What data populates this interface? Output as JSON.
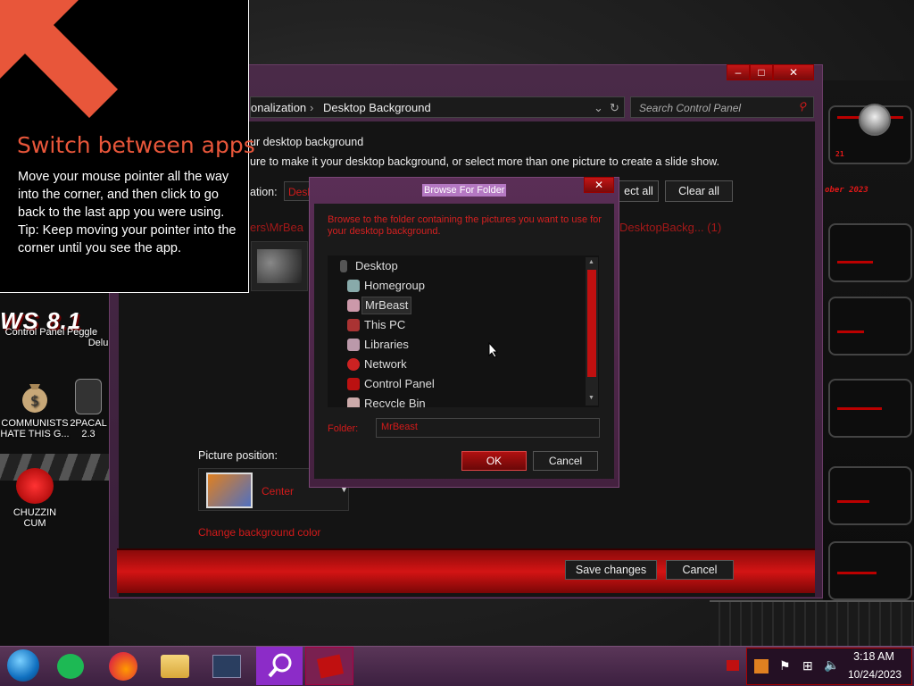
{
  "tip": {
    "title": "Switch between apps",
    "body": "Move your mouse pointer all the way into the corner, and then click to go back to the last app you were using.",
    "tip_line": "Tip: Keep moving your pointer into the corner until you see the app."
  },
  "desktop": {
    "logo_text": "WS 8.1",
    "icons": [
      {
        "label": "Control Panel"
      },
      {
        "label": "Peggle",
        "label2": "Delu"
      },
      {
        "label": "COMMUNISTS",
        "label2": "HATE THIS G..."
      },
      {
        "label": "2PACAL",
        "label2": "2.3"
      },
      {
        "label": "CHUZZIN",
        "label2": "CUM"
      }
    ]
  },
  "control_panel": {
    "breadcrumb_1": "onalization",
    "breadcrumb_2": "Desktop Background",
    "search_placeholder": "Search Control Panel",
    "heading": "ur desktop background",
    "subheading": "ure to make it your desktop background, or select more than one picture to create a slide show.",
    "location_label": "ation:",
    "location_value": "Desk",
    "select_all": "ect all",
    "clear_all": "Clear all",
    "path_left": "ers\\MrBea",
    "path_right": "DesktopBackg... (1)",
    "picture_position_label": "Picture position:",
    "picture_position_value": "Center",
    "change_bg_color": "Change background color",
    "save_changes": "Save changes",
    "cancel": "Cancel"
  },
  "dialog": {
    "title": "Browse For Folder",
    "description": "Browse to the folder containing the pictures you want to use for your desktop background.",
    "tree": [
      {
        "label": "Desktop"
      },
      {
        "label": "Homegroup"
      },
      {
        "label": "MrBeast"
      },
      {
        "label": "This PC"
      },
      {
        "label": "Libraries"
      },
      {
        "label": "Network"
      },
      {
        "label": "Control Panel"
      },
      {
        "label": "Recycle Bin"
      }
    ],
    "selected": "MrBeast",
    "folder_label": "Folder:",
    "folder_value": "MrBeast",
    "ok": "OK",
    "cancel": "Cancel"
  },
  "widgets": {
    "date_fragment": "ober 2023",
    "num_fragment": "21"
  },
  "taskbar": {
    "time": "3:18 AM",
    "date": "10/24/2023"
  },
  "colors": {
    "accent_red": "#d21a1a",
    "window_purple": "#4a2a48",
    "tip_orange": "#e8563a"
  }
}
